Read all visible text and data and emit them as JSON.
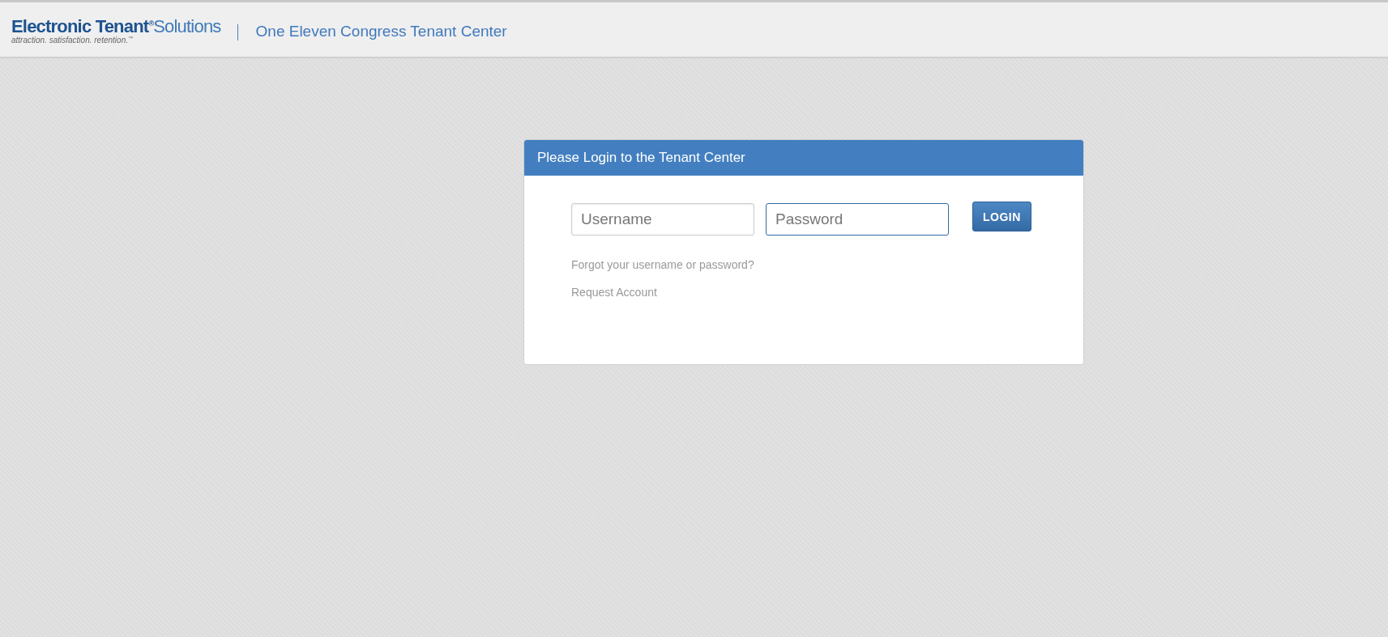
{
  "header": {
    "logo": {
      "primary": "Electronic Tenant$^{®}$",
      "secondary": "Solutions",
      "tagline": "attraction. satisfaction. retention.$^{™}$"
    },
    "site_title": "One Eleven Congress Tenant Center"
  },
  "login_panel": {
    "title": "Please Login to the Tenant Center",
    "fields": [
      {
        "placeholder": "Username",
        "focused": false
      },
      {
        "placeholder": "Password",
        "focused": true
      }
    ],
    "button": "LOGIN",
    "links": [
      "Forgot your username or password?",
      "Request Account"
    ]
  }
}
